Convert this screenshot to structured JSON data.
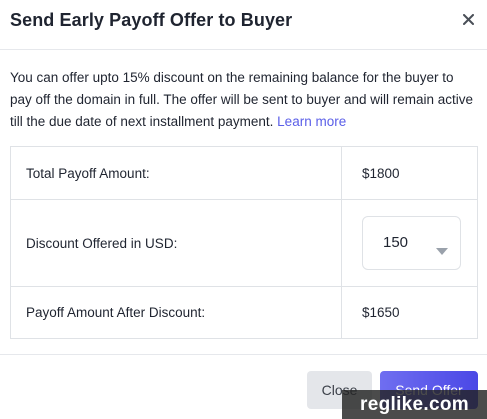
{
  "modal": {
    "title": "Send Early Payoff Offer to Buyer",
    "close_icon": "close-icon"
  },
  "description": {
    "text": "You can offer upto 15% discount on the remaining balance for the buyer to pay off the domain in full. The offer will be sent to buyer and will remain active till the due date of next installment payment.",
    "link_label": "Learn more"
  },
  "table": {
    "rows": [
      {
        "label": "Total Payoff Amount:",
        "value": "$1800"
      },
      {
        "label": "Discount Offered in USD:",
        "value": "150"
      },
      {
        "label": "Payoff Amount After Discount:",
        "value": "$1650"
      }
    ],
    "dropdown_icon": "chevron-down-icon"
  },
  "footer": {
    "close_label": "Close",
    "send_label": "Send Offer"
  },
  "watermark": "reglike.com",
  "colors": {
    "accent": "#5a5ee8",
    "send_button": "#5a58ec",
    "close_button": "#e4e6ea"
  }
}
